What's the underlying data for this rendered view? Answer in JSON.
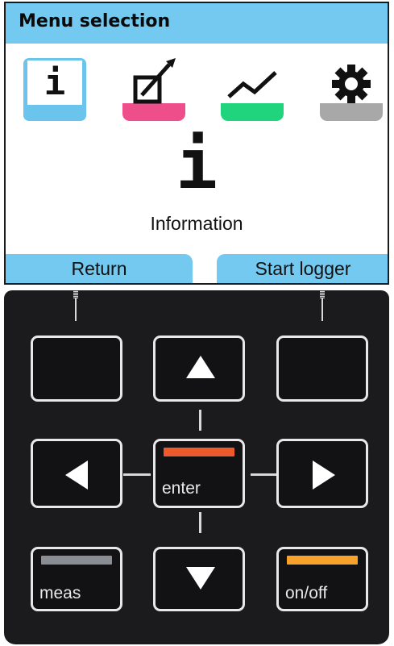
{
  "screen": {
    "title": "Menu selection",
    "menu_icons": [
      {
        "name": "information",
        "glyph": "i",
        "color": "#6bc4ec",
        "selected": true
      },
      {
        "name": "calibration",
        "color": "#ee4f8a"
      },
      {
        "name": "logger",
        "color": "#20d47e"
      },
      {
        "name": "settings",
        "color": "#a8a8a8"
      }
    ],
    "selected_glyph": "i",
    "selected_label": "Information",
    "softkeys": {
      "left": "Return",
      "right": "Start logger"
    }
  },
  "keypad": {
    "enter_label": "enter",
    "meas_label": "meas",
    "onoff_label": "on/off",
    "colors": {
      "enter_bar": "#ee5a2c",
      "meas_bar": "#8a8d94",
      "onoff_bar": "#f7a32b"
    }
  }
}
